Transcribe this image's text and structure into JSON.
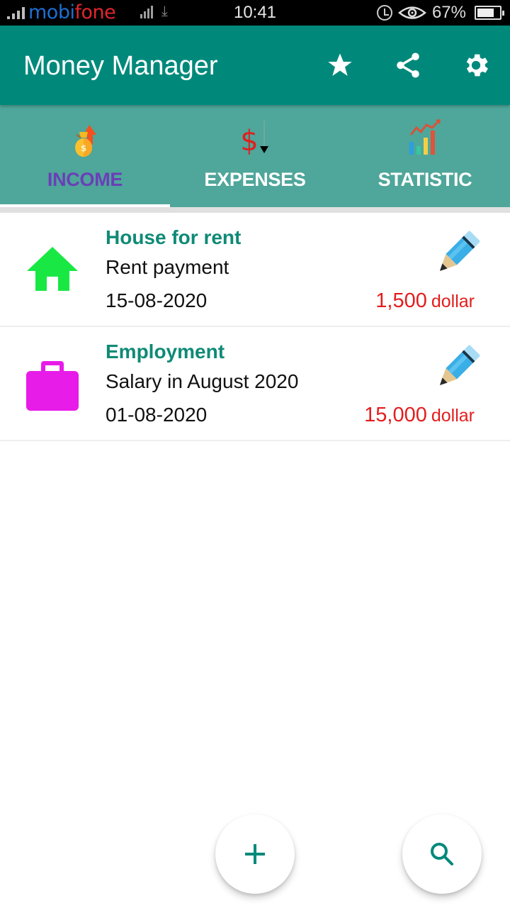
{
  "status_bar": {
    "carrier_part1": "mobi",
    "carrier_part2": "fone",
    "time": "10:41",
    "battery": "67%",
    "battery_level": 0.67,
    "icons": [
      "signal-icon",
      "mobile-data-icon",
      "download-icon",
      "alarm-icon",
      "eye-comfort-icon",
      "battery-icon"
    ]
  },
  "app_bar": {
    "title": "Money Manager",
    "actions": [
      {
        "name": "favorite",
        "icon": "star-icon"
      },
      {
        "name": "share",
        "icon": "share-icon"
      },
      {
        "name": "settings",
        "icon": "gear-icon"
      }
    ]
  },
  "tabs": [
    {
      "label": "INCOME",
      "icon": "money-bag-up-icon",
      "active": true
    },
    {
      "label": "EXPENSES",
      "icon": "dollar-down-icon",
      "active": false
    },
    {
      "label": "STATISTIC",
      "icon": "bar-chart-trend-icon",
      "active": false
    }
  ],
  "colors": {
    "primary": "#00897b",
    "tab_bar": "#4fa69a",
    "active_tab_label": "#6a3fb8",
    "category_name": "#0f8a76",
    "amount": "#e41d1d"
  },
  "income_items": [
    {
      "category": "House for rent",
      "description": "Rent payment",
      "date": "15-08-2020",
      "amount": "1,500",
      "currency": "dollar",
      "icon": "house-icon",
      "icon_color": "#19e844"
    },
    {
      "category": "Employment",
      "description": "Salary in August 2020",
      "date": "01-08-2020",
      "amount": "15,000",
      "currency": "dollar",
      "icon": "briefcase-icon",
      "icon_color": "#e81ce8"
    }
  ],
  "fabs": {
    "add": {
      "icon": "plus-icon"
    },
    "search": {
      "icon": "search-icon"
    }
  }
}
